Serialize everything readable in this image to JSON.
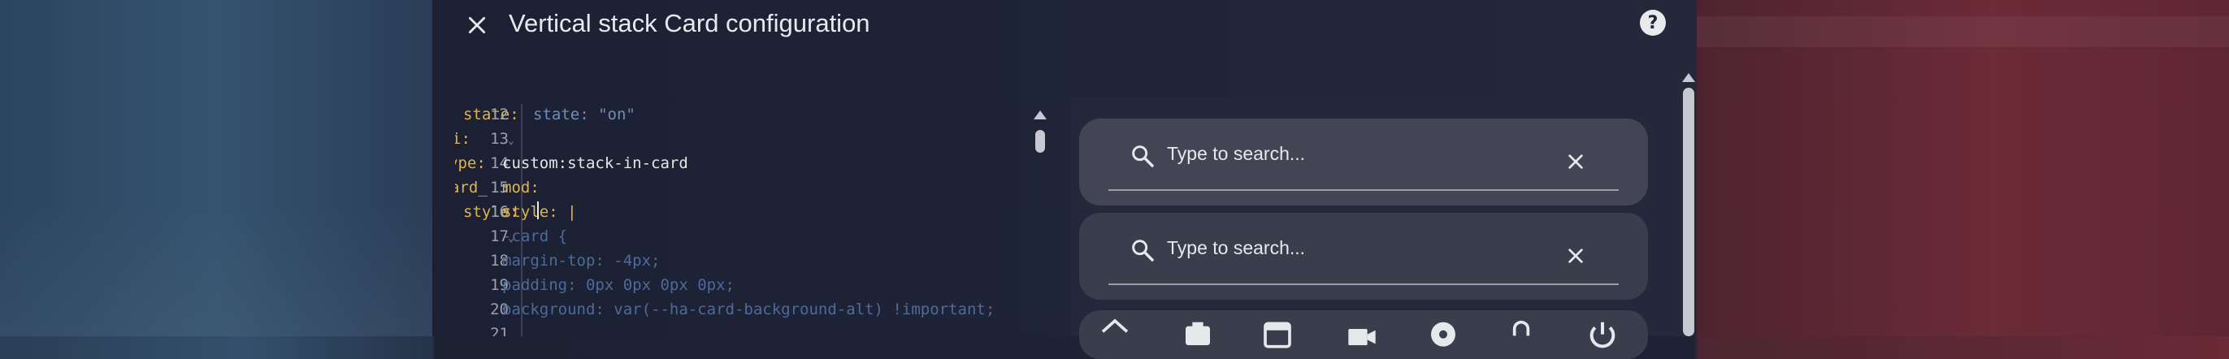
{
  "dialog": {
    "title": "Vertical stack Card configuration",
    "close_icon": "close-icon",
    "help_icon": "help-icon",
    "help_glyph": "?"
  },
  "editor": {
    "lines": [
      {
        "num": "12",
        "text": "state: \"on\""
      },
      {
        "num": "13",
        "text": ""
      },
      {
        "num": "14",
        "text": "custom:stack-in-card"
      },
      {
        "num": "15",
        "text": "mod:"
      },
      {
        "num": "16",
        "text": "style: |"
      },
      {
        "num": "17",
        "text": "-card {"
      },
      {
        "num": "18",
        "text": "margin-top: -4px;"
      },
      {
        "num": "19",
        "text": "padding: 0px 0px 0px 0px;"
      },
      {
        "num": "20",
        "text": "background: var(--ha-card-background-alt) !important;"
      },
      {
        "num": "21",
        "text": ""
      }
    ],
    "overlap_fragments": {
      "l12_key": "state:",
      "l13_key": "i:",
      "l14_key": "ype:",
      "l15_key": "ard_",
      "l16_key": "style:"
    }
  },
  "preview": {
    "search_cards": [
      {
        "placeholder": "Type to search...",
        "search_icon": "search-icon",
        "clear_icon": "close-icon"
      },
      {
        "placeholder": "Type to search...",
        "search_icon": "search-icon",
        "clear_icon": "close-icon"
      }
    ],
    "icon_row": [
      "home-icon",
      "camera-icon",
      "calendar-icon",
      "video-icon",
      "settings-icon",
      "lock-icon",
      "power-icon"
    ]
  },
  "colors": {
    "accent_key": "#e0b34f",
    "string": "#6e8dbd",
    "card": "#434555",
    "dialog_bg": "#1f2438"
  }
}
